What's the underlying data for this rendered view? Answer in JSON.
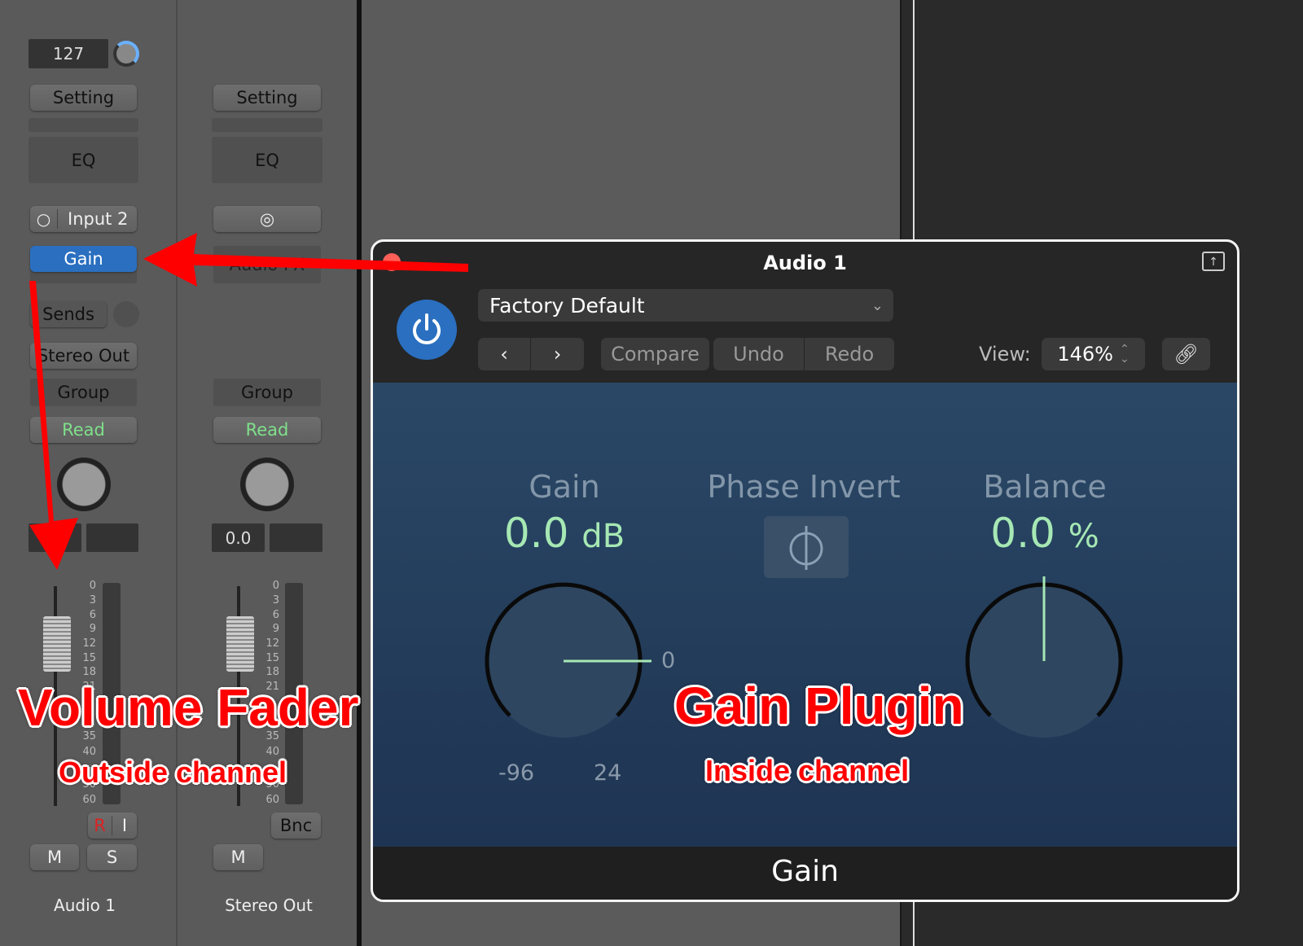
{
  "channel_strips": [
    {
      "name": "Audio 1",
      "value_display": "127",
      "setting": "Setting",
      "eq": "EQ",
      "input": "Input 2",
      "plugin_slot": "Gain",
      "sends": "Sends",
      "output": "Stereo Out",
      "group": "Group",
      "automation": "Read",
      "volume_display": "",
      "pan_display": "",
      "record": "R",
      "input_monitor": "I",
      "mute": "M",
      "solo": "S",
      "fader_scale": [
        "0",
        "3",
        "6",
        "9",
        "12",
        "15",
        "18",
        "21",
        "35",
        "40",
        "50",
        "60"
      ]
    },
    {
      "name": "Stereo Out",
      "setting": "Setting",
      "eq": "EQ",
      "input_icon": "stereo-link-icon",
      "plugin_slot": "Audio FX",
      "group": "Group",
      "automation": "Read",
      "volume_display": "0.0",
      "pan_display": "",
      "bounce": "Bnc",
      "mute": "M",
      "fader_scale": [
        "0",
        "3",
        "6",
        "9",
        "12",
        "15",
        "18",
        "21",
        "35",
        "40",
        "50",
        "60"
      ]
    }
  ],
  "plugin_window": {
    "title": "Audio 1",
    "preset": "Factory Default",
    "compare": "Compare",
    "undo": "Undo",
    "redo": "Redo",
    "view_label": "View:",
    "view_value": "146%",
    "footer": "Gain",
    "gain": {
      "label": "Gain",
      "value": "0.0",
      "unit": "dB",
      "marker": "0",
      "min": "-96",
      "max": "24"
    },
    "phase_invert": {
      "label": "Phase Invert"
    },
    "balance": {
      "label": "Balance",
      "value": "0.0",
      "unit": "%"
    }
  },
  "annotations": {
    "fader_title": "Volume Fader",
    "fader_sub": "Outside channel",
    "plugin_title": "Gain Plugin",
    "plugin_sub": "Inside channel"
  },
  "colors": {
    "accent_blue": "#2a6fc0",
    "read_green": "#7fe08a",
    "value_green": "#a6e8b4",
    "annotation_red": "#ff0000"
  }
}
